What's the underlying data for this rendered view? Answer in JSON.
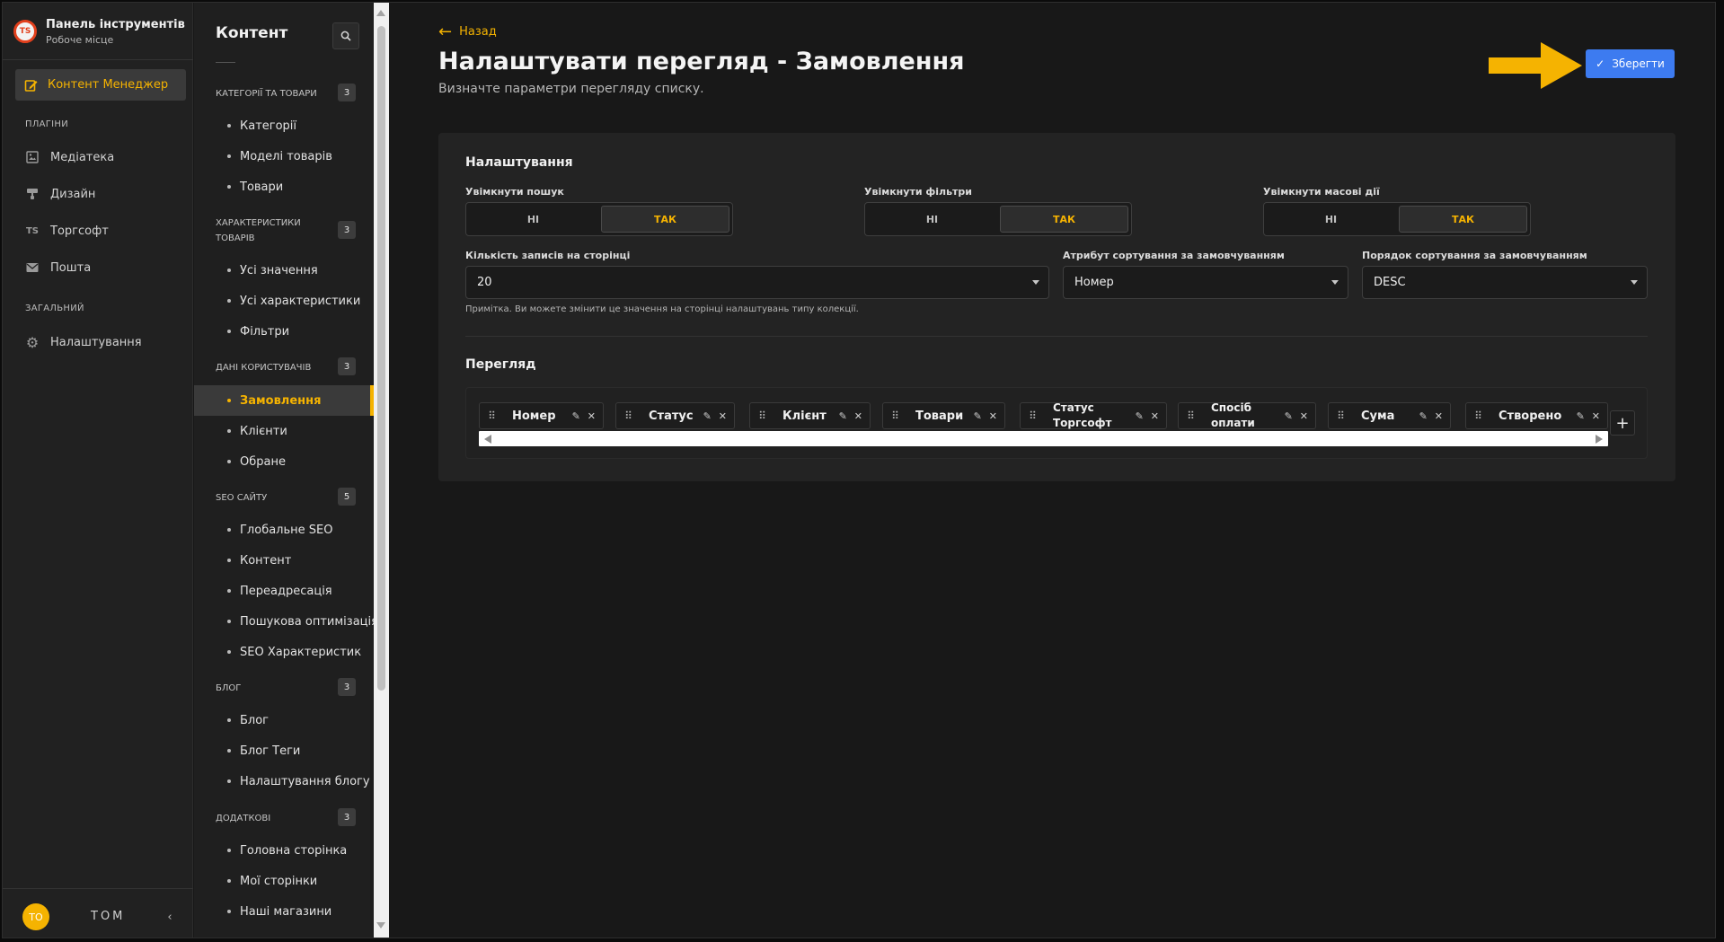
{
  "nav": {
    "brand_title": "Панель інструментів",
    "brand_sub": "Робоче місце",
    "brand_logo": "TS",
    "active_item": "Контент Менеджер",
    "sections": {
      "plugins": "ПЛАГІНИ",
      "general": "ЗАГАЛЬНИЙ"
    },
    "items": [
      {
        "icon": "media-icon",
        "label": "Медіатека"
      },
      {
        "icon": "design-icon",
        "label": "Дизайн"
      },
      {
        "icon": "torgsoft-icon",
        "label": "Торгсофт"
      },
      {
        "icon": "mail-icon",
        "label": "Пошта"
      },
      {
        "icon": "gear-icon",
        "label": "Налаштування"
      }
    ],
    "avatar": "TO",
    "user": "TOM"
  },
  "side": {
    "title": "Контент",
    "groups": [
      {
        "title": "КАТЕГОРІЇ ТА ТОВАРИ",
        "count": "3",
        "items": [
          "Категорії",
          "Моделі товарів",
          "Товари"
        ]
      },
      {
        "title": "ХАРАКТЕРИСТИКИ ТОВАРІВ",
        "count": "3",
        "items": [
          "Усі значення",
          "Усі характеристики",
          "Фільтри"
        ]
      },
      {
        "title": "ДАНІ КОРИСТУВАЧІВ",
        "count": "3",
        "items": [
          "Замовлення",
          "Клієнти",
          "Обране"
        ]
      },
      {
        "title": "SEO САЙТУ",
        "count": "5",
        "items": [
          "Глобальне SEO",
          "Контент",
          "Переадресація",
          "Пошукова оптимізація",
          "SEO Характеристик"
        ]
      },
      {
        "title": "БЛОГ",
        "count": "3",
        "items": [
          "Блог",
          "Блог Теги",
          "Налаштування блогу"
        ]
      },
      {
        "title": "ДОДАТКОВІ",
        "count": "3",
        "items": [
          "Головна сторінка",
          "Мої сторінки",
          "Наші магазини"
        ]
      }
    ],
    "active": "Замовлення"
  },
  "main": {
    "back": "Назад",
    "title": "Налаштувати перегляд - Замовлення",
    "subtitle": "Визначте параметри перегляду списку.",
    "save": "Зберегти",
    "settings_title": "Налаштування",
    "toggles": [
      {
        "label": "Увімкнути пошук",
        "no": "НІ",
        "yes": "ТАК",
        "value": "ТАК"
      },
      {
        "label": "Увімкнути фільтри",
        "no": "НІ",
        "yes": "ТАК",
        "value": "ТАК"
      },
      {
        "label": "Увімкнути масові дії",
        "no": "НІ",
        "yes": "ТАК",
        "value": "ТАК"
      }
    ],
    "selects": [
      {
        "label": "Кількість записів на сторінці",
        "value": "20"
      },
      {
        "label": "Атрибут сортування за замовчуванням",
        "value": "Номер"
      },
      {
        "label": "Порядок сортування за замовчуванням",
        "value": "DESC"
      }
    ],
    "note": "Примітка. Ви можете змінити це значення на сторінці налаштувань типу колекції.",
    "view_title": "Перегляд",
    "columns": [
      "Номер",
      "Статус",
      "Клієнт",
      "Товари",
      "Статус Торгсофт",
      "Спосіб оплати",
      "Сума",
      "Створено"
    ],
    "add_column": "+"
  },
  "colors": {
    "accent": "#f5b301",
    "primary": "#3d7bf0"
  }
}
